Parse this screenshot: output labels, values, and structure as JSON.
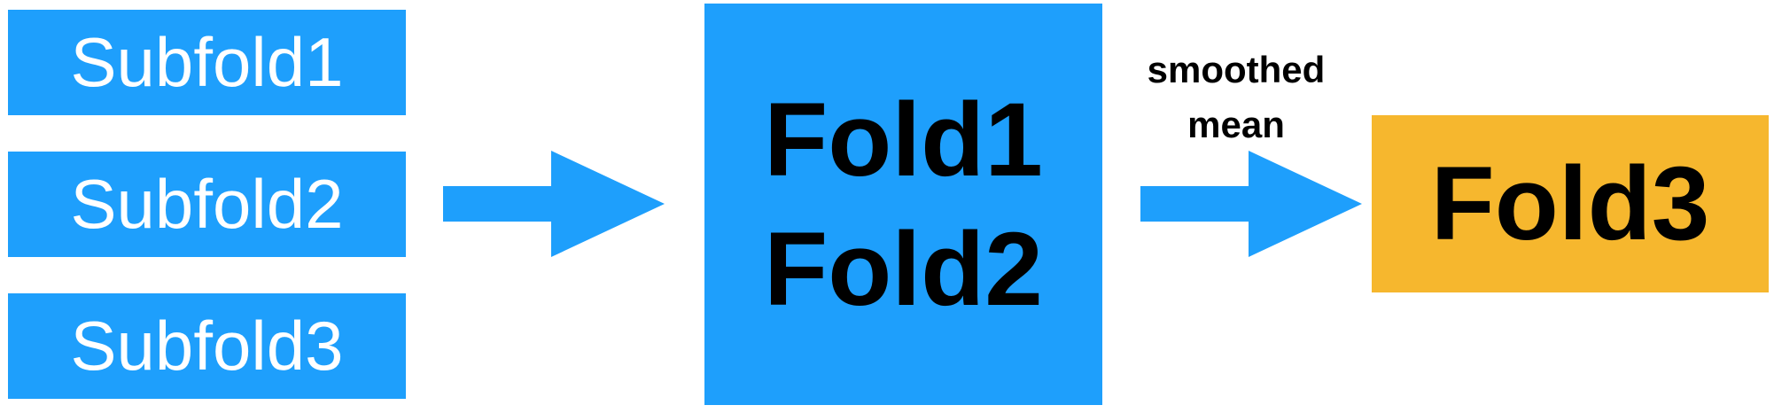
{
  "colors": {
    "blue": "#1E9FFC",
    "orange": "#F6B72E",
    "white_text": "#FFFFFF",
    "black_text": "#000000"
  },
  "subfolds": [
    "Subfold1",
    "Subfold2",
    "Subfold3"
  ],
  "middle_box": {
    "lines": [
      "Fold1",
      "Fold2"
    ]
  },
  "edge_label": {
    "lines": [
      "smoothed",
      "mean"
    ]
  },
  "result_box": {
    "label": "Fold3"
  }
}
